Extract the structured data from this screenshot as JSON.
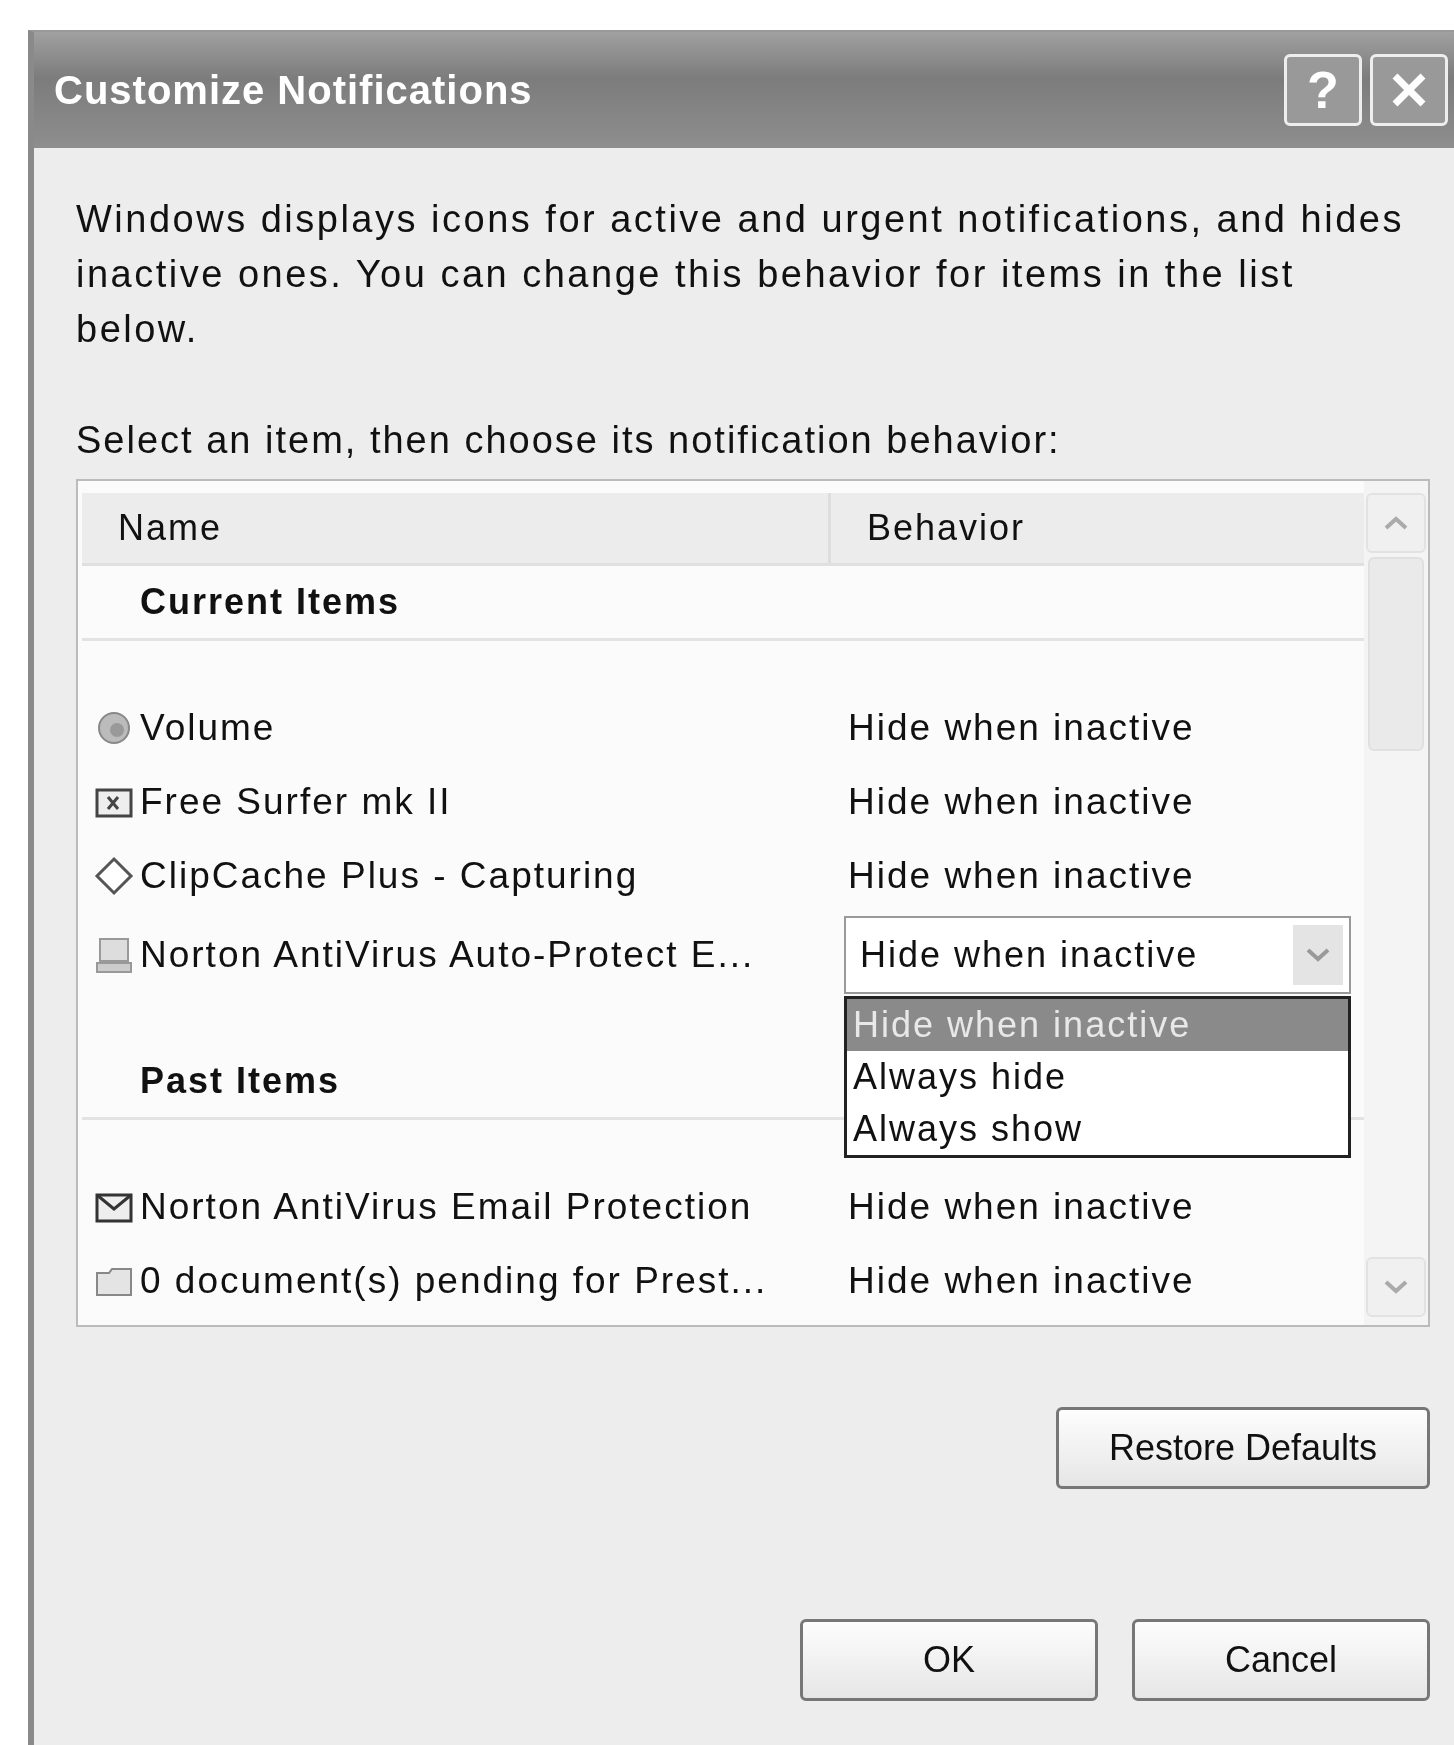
{
  "window": {
    "title": "Customize Notifications",
    "help_button": "?"
  },
  "description": "Windows displays icons for active and urgent notifications, and hides inactive ones. You can change this behavior for items in the list below.",
  "instruction": "Select an item, then choose its notification behavior:",
  "list": {
    "columns": [
      "Name",
      "Behavior"
    ],
    "groups": [
      {
        "title": "Current Items",
        "items": [
          {
            "name": "Volume",
            "behavior": "Hide when inactive",
            "editing": false
          },
          {
            "name": "Free Surfer mk II",
            "behavior": "Hide when inactive",
            "editing": false
          },
          {
            "name": "ClipCache Plus - Capturing",
            "behavior": "Hide when inactive",
            "editing": false
          },
          {
            "name": "Norton AntiVirus Auto-Protect E...",
            "behavior": "Hide when inactive",
            "editing": true
          }
        ]
      },
      {
        "title": "Past Items",
        "items": [
          {
            "name": "Norton AntiVirus Email Protection",
            "behavior": "Hide when inactive",
            "editing": false
          },
          {
            "name": "0 document(s) pending for Prest...",
            "behavior": "Hide when inactive",
            "editing": false
          }
        ]
      }
    ]
  },
  "dropdown": {
    "expanded": true,
    "options": [
      {
        "label": "Hide when inactive",
        "selected": true
      },
      {
        "label": "Always hide",
        "selected": false
      },
      {
        "label": "Always show",
        "selected": false
      }
    ]
  },
  "buttons": {
    "restore": "Restore Defaults",
    "ok": "OK",
    "cancel": "Cancel"
  }
}
